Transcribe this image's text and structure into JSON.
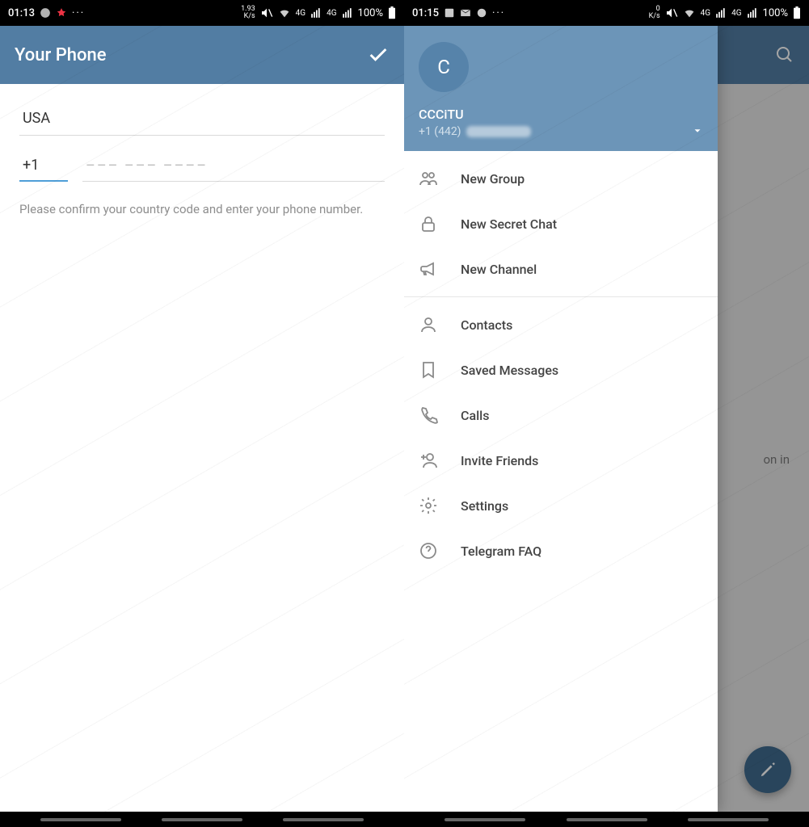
{
  "left": {
    "status": {
      "time": "01:13",
      "speed": "1.93\nK/s",
      "battery": "100%"
    },
    "appbar": {
      "title": "Your Phone"
    },
    "form": {
      "country": "USA",
      "code": "+1",
      "placeholder": "––– ––– ––––",
      "help": "Please confirm your country code and enter your phone number."
    }
  },
  "right": {
    "status": {
      "time": "01:15",
      "speed": "0\nK/s",
      "battery": "100%"
    },
    "bg_text": "on in",
    "drawer": {
      "avatar_initial": "C",
      "username": "CCCiTU",
      "phone_prefix": "+1 (442)",
      "sections": [
        [
          {
            "id": "new-group",
            "label": "New Group",
            "icon": "group"
          },
          {
            "id": "new-secret-chat",
            "label": "New Secret Chat",
            "icon": "lock"
          },
          {
            "id": "new-channel",
            "label": "New Channel",
            "icon": "megaphone"
          }
        ],
        [
          {
            "id": "contacts",
            "label": "Contacts",
            "icon": "person"
          },
          {
            "id": "saved-messages",
            "label": "Saved Messages",
            "icon": "bookmark"
          },
          {
            "id": "calls",
            "label": "Calls",
            "icon": "phone"
          },
          {
            "id": "invite-friends",
            "label": "Invite Friends",
            "icon": "invite"
          },
          {
            "id": "settings",
            "label": "Settings",
            "icon": "gear"
          },
          {
            "id": "telegram-faq",
            "label": "Telegram FAQ",
            "icon": "help"
          }
        ]
      ]
    }
  }
}
